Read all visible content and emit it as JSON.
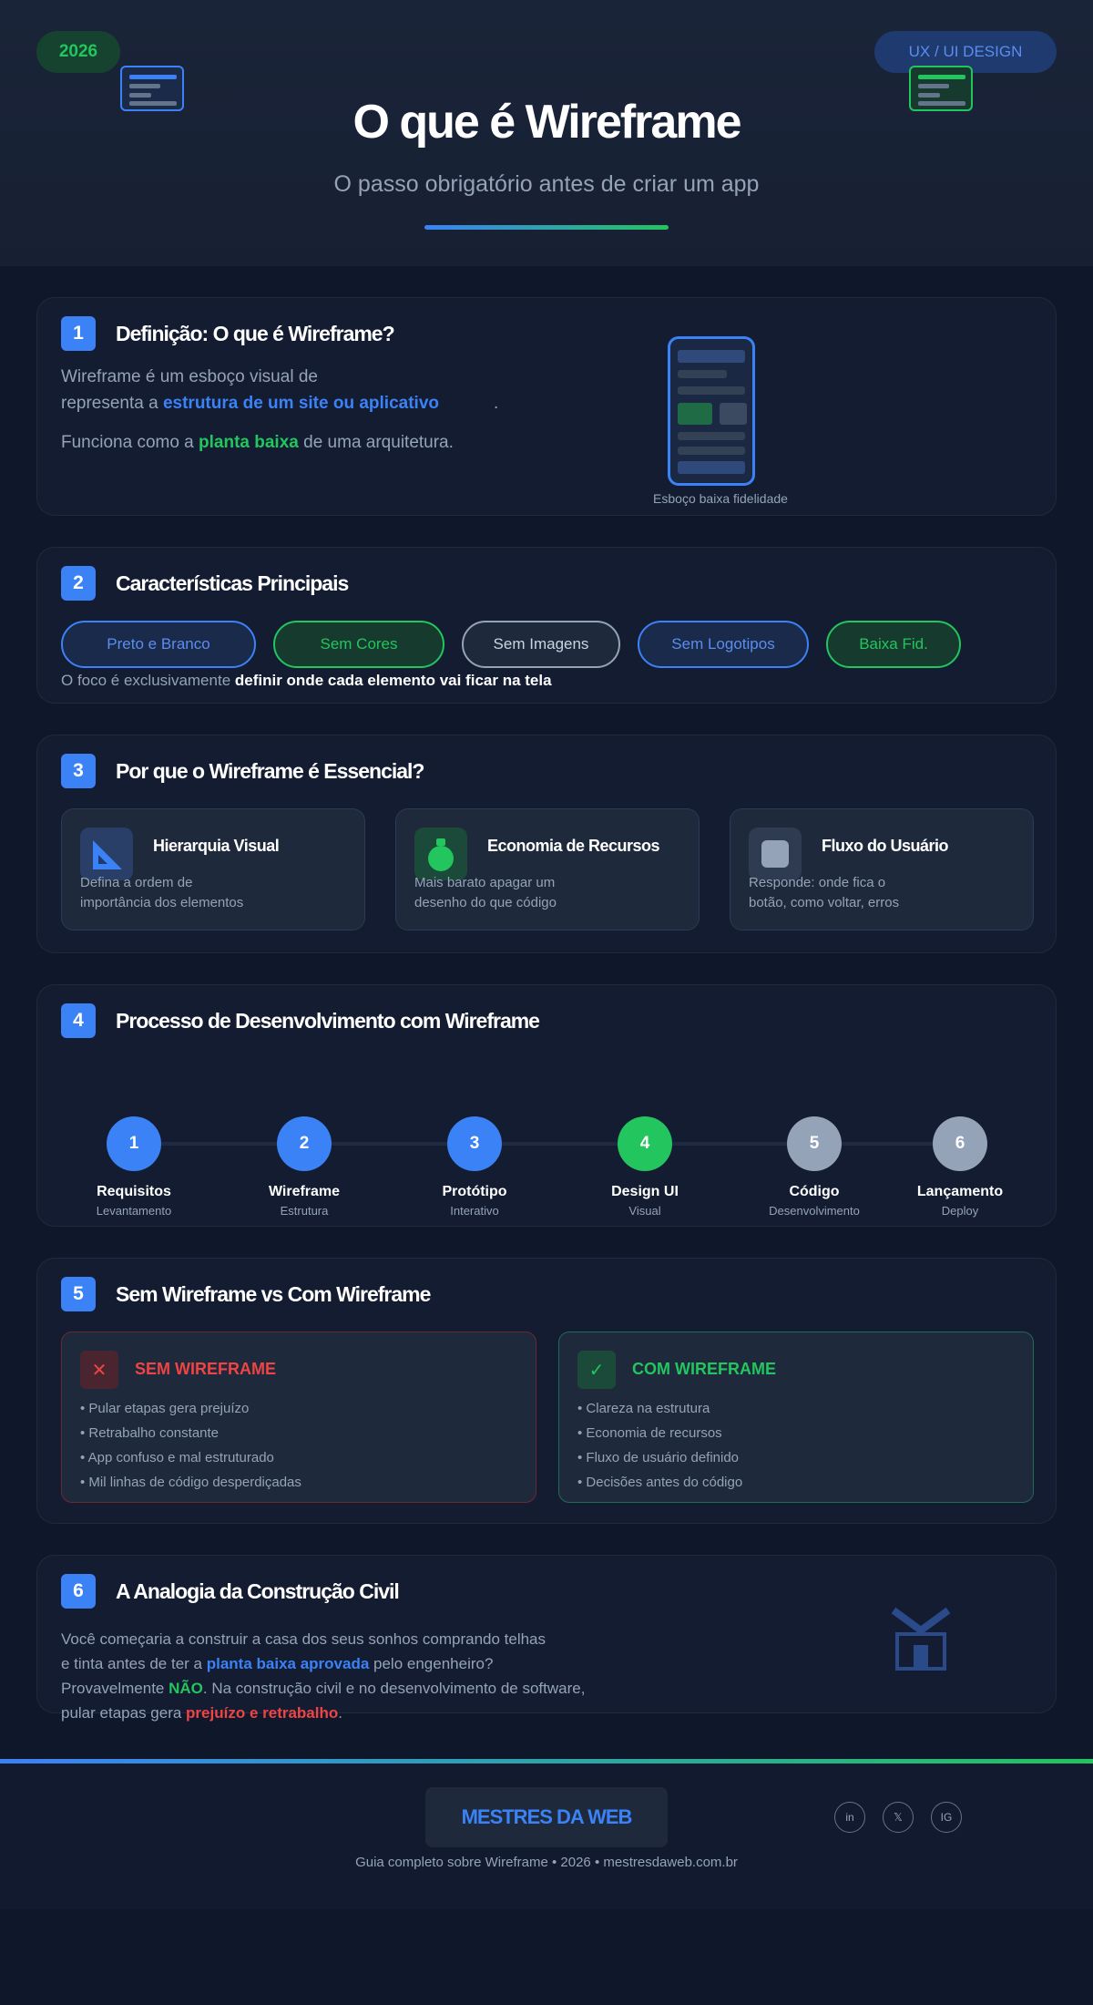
{
  "header": {
    "year_badge": "2026",
    "tag_badge": "UX / UI DESIGN",
    "title": "O que é Wireframe",
    "subtitle": "O passo obrigatório antes de criar um app"
  },
  "section1": {
    "number": "1",
    "title": "Definição: O que é Wireframe?",
    "p1_a": "Wireframe é um esboço visual de",
    "p1_b": "representa a ",
    "p1_hl": "estrutura de um site ou aplicativo",
    "p1_end": ".",
    "p2_a": "Funciona como a ",
    "p2_hl": "planta baixa",
    "p2_b": " de uma arquitetura.",
    "phone_caption": "Esboço baixa fidelidade"
  },
  "section2": {
    "number": "2",
    "title": "Características Principais",
    "chips": [
      "Preto e Branco",
      "Sem Cores",
      "Sem Imagens",
      "Sem Logotipos",
      "Baixa Fid."
    ],
    "note_a": "O foco é exclusivamente ",
    "note_hl": "definir onde cada elemento vai ficar na tela"
  },
  "section3": {
    "number": "3",
    "title": "Por que o Wireframe é Essencial?",
    "cards": [
      {
        "title": "Hierarquia Visual",
        "line1": "Defina a ordem de",
        "line2": "importância dos elementos"
      },
      {
        "title": "Economia de Recursos",
        "line1": "Mais barato apagar um",
        "line2": "desenho do que código"
      },
      {
        "title": "Fluxo do Usuário",
        "line1": "Responde: onde fica o",
        "line2": "botão, como voltar, erros"
      }
    ]
  },
  "section4": {
    "number": "4",
    "title": "Processo de Desenvolvimento com Wireframe",
    "steps": [
      {
        "n": "1",
        "label": "Requisitos",
        "sub": "Levantamento"
      },
      {
        "n": "2",
        "label": "Wireframe",
        "sub": "Estrutura"
      },
      {
        "n": "3",
        "label": "Protótipo",
        "sub": "Interativo"
      },
      {
        "n": "4",
        "label": "Design UI",
        "sub": "Visual"
      },
      {
        "n": "5",
        "label": "Código",
        "sub": "Desenvolvimento"
      },
      {
        "n": "6",
        "label": "Lançamento",
        "sub": "Deploy"
      }
    ]
  },
  "section5": {
    "number": "5",
    "title": "Sem Wireframe vs Com Wireframe",
    "without": {
      "icon": "✕",
      "heading": "SEM WIREFRAME",
      "items": [
        "• Pular etapas gera prejuízo",
        "• Retrabalho constante",
        "• App confuso e mal estruturado",
        "• Mil linhas de código desperdiçadas"
      ]
    },
    "with": {
      "icon": "✓",
      "heading": "COM WIREFRAME",
      "items": [
        "• Clareza na estrutura",
        "• Economia de recursos",
        "• Fluxo de usuário definido",
        "• Decisões antes do código"
      ]
    }
  },
  "section6": {
    "number": "6",
    "title": "A Analogia da Construção Civil",
    "l1": "Você começaria a construir a casa dos seus sonhos comprando telhas",
    "l2_a": "e tinta antes de ter a ",
    "l2_hl": "planta baixa aprovada",
    "l2_b": " pelo engenheiro?",
    "l3_a": "Provavelmente ",
    "l3_hl": "NÃO",
    "l3_b": ". Na construção civil e no desenvolvimento de software,",
    "l4_a": "pular etapas gera ",
    "l4_hl": "prejuízo e retrabalho",
    "l4_b": "."
  },
  "footer": {
    "brand": "MESTRES DA WEB",
    "social": [
      "in",
      "𝕏",
      "IG"
    ],
    "text": "Guia completo sobre Wireframe • 2026 • mestresdaweb.com.br"
  },
  "colors": {
    "bg": "#0f172a",
    "blue": "#3b82f6",
    "green": "#22c55e",
    "red": "#ef4444",
    "muted": "#94a3b8"
  }
}
